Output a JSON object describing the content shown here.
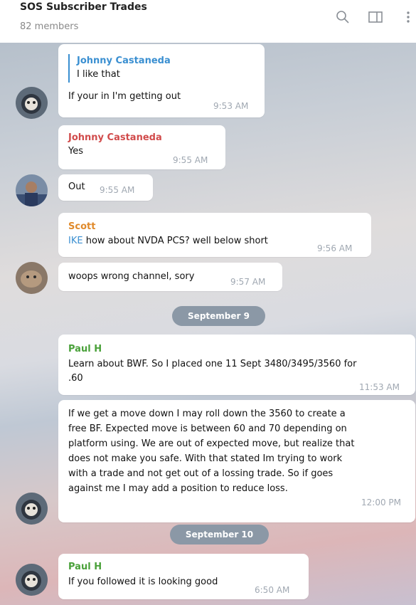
{
  "header": {
    "title": "SOS Subscriber Trades",
    "subtitle": "82 members"
  },
  "icons": {
    "search": "search-icon",
    "panel": "sidebar-toggle-icon",
    "menu": "more-vertical-icon"
  },
  "colors": {
    "johnny": "#3a8fd1",
    "johnny_red": "#d14b4b",
    "scott": "#e08a2b",
    "paul": "#4aa13a",
    "mention": "#3a8fd1",
    "date_pill": "#8b98a6"
  },
  "messages": {
    "m1": {
      "reply_sender": "Johnny Castaneda",
      "reply_text": "I like that",
      "text": "If your in I'm getting out",
      "time": "9:53 AM"
    },
    "m2": {
      "sender": "Johnny Castaneda",
      "text": "Yes",
      "time": "9:55 AM"
    },
    "m3": {
      "text": "Out",
      "time": "9:55 AM"
    },
    "m4": {
      "sender": "Scott",
      "mention": "IKE",
      "text": " how about NVDA PCS?  well below short",
      "time": "9:56 AM"
    },
    "m5": {
      "text": "woops wrong channel, sory",
      "time": "9:57 AM"
    },
    "d1": {
      "label": "September 9"
    },
    "m6": {
      "sender": "Paul H",
      "line1": "Learn about BWF.  So I placed one 11 Sept 3480/3495/3560 for",
      "line2": ".60",
      "time": "11:53 AM"
    },
    "m7": {
      "line1": "If we get a move down I may roll down the 3560 to create a",
      "line2": "free BF.  Expected move is between 60 and 70 depending on",
      "line3": "platform using.  We are out of expected move, but realize that",
      "line4": "does not make you safe. With that stated Im trying to work",
      "line5": "with a trade and not get out of a lossing trade.  So if goes",
      "line6": "against me I may add a position to reduce loss.",
      "time": "12:00 PM"
    },
    "d2": {
      "label": "September 10"
    },
    "m8": {
      "sender": "Paul H",
      "text": "If you followed it is looking good",
      "time": "6:50 AM"
    }
  }
}
